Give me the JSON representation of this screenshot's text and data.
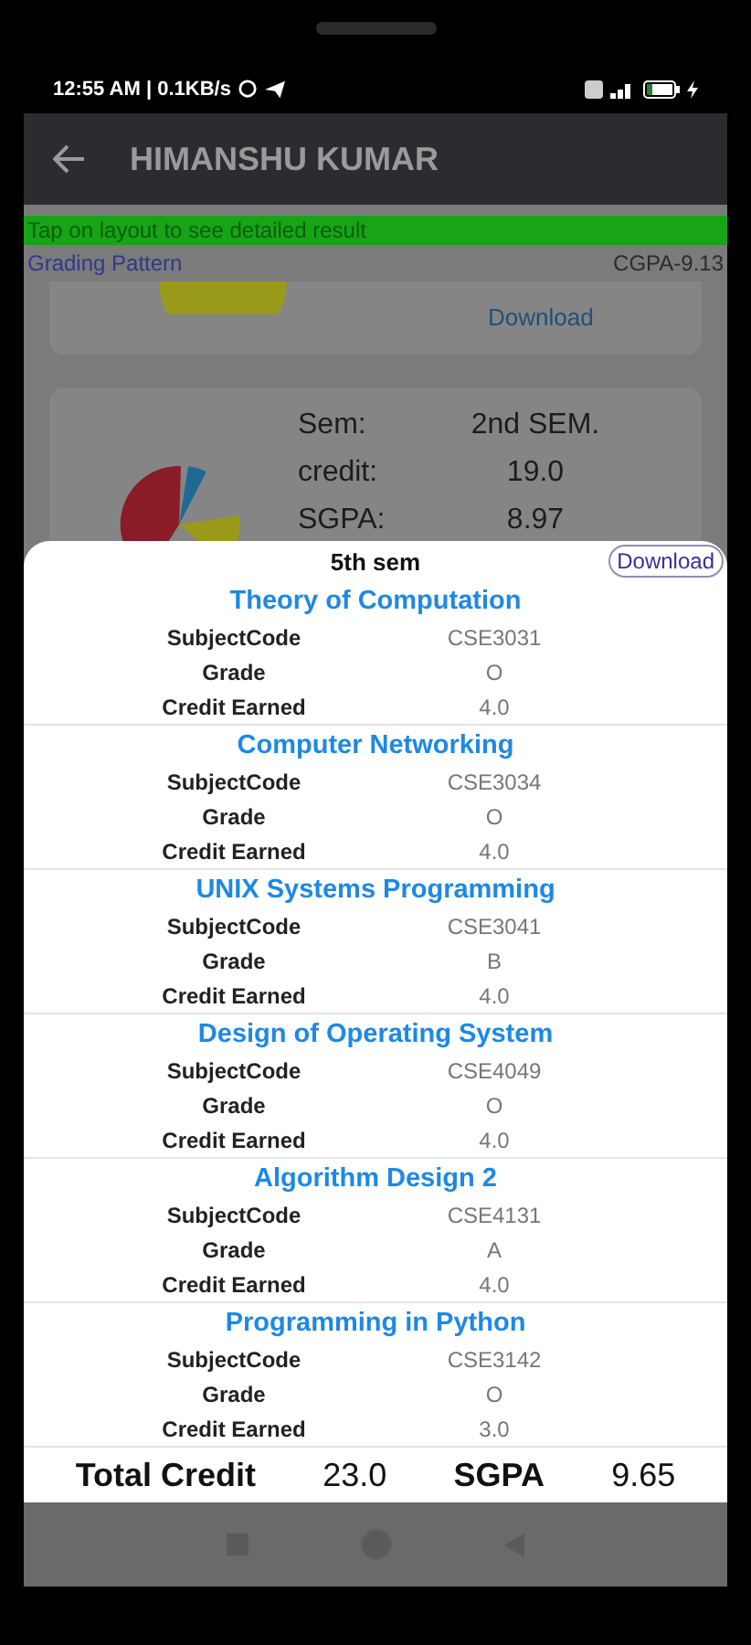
{
  "status_bar": {
    "time": "12:55 AM | 0.1KB/s"
  },
  "app_bar": {
    "title": "HIMANSHU KUMAR"
  },
  "banner": "Tap on layout to see detailed result",
  "grading_link": "Grading Pattern",
  "cgpa": "CGPA-9.13",
  "first_card": {
    "action": "Download"
  },
  "second_card": {
    "fields": [
      {
        "label": "Sem:",
        "value": "2nd SEM."
      },
      {
        "label": "credit:",
        "value": "19.0"
      },
      {
        "label": "SGPA:",
        "value": "8.97"
      }
    ]
  },
  "sheet": {
    "title": "5th sem",
    "download": "Download",
    "subjects": [
      {
        "name": "Theory of Computation",
        "rows": [
          {
            "label": "SubjectCode",
            "value": "CSE3031"
          },
          {
            "label": "Grade",
            "value": "O"
          },
          {
            "label": "Credit Earned",
            "value": "4.0"
          }
        ]
      },
      {
        "name": "Computer Networking",
        "rows": [
          {
            "label": "SubjectCode",
            "value": "CSE3034"
          },
          {
            "label": "Grade",
            "value": "O"
          },
          {
            "label": "Credit Earned",
            "value": "4.0"
          }
        ]
      },
      {
        "name": "UNIX Systems Programming",
        "rows": [
          {
            "label": "SubjectCode",
            "value": "CSE3041"
          },
          {
            "label": "Grade",
            "value": "B"
          },
          {
            "label": "Credit Earned",
            "value": "4.0"
          }
        ]
      },
      {
        "name": "Design of Operating System",
        "rows": [
          {
            "label": "SubjectCode",
            "value": "CSE4049"
          },
          {
            "label": "Grade",
            "value": "O"
          },
          {
            "label": "Credit Earned",
            "value": "4.0"
          }
        ]
      },
      {
        "name": "Algorithm Design 2",
        "rows": [
          {
            "label": "SubjectCode",
            "value": "CSE4131"
          },
          {
            "label": "Grade",
            "value": "A"
          },
          {
            "label": "Credit Earned",
            "value": "4.0"
          }
        ]
      },
      {
        "name": "Programming in Python",
        "rows": [
          {
            "label": "SubjectCode",
            "value": "CSE3142"
          },
          {
            "label": "Grade",
            "value": "O"
          },
          {
            "label": "Credit Earned",
            "value": "3.0"
          }
        ]
      }
    ],
    "totals": [
      {
        "label": "Total Credit",
        "value": "23.0"
      },
      {
        "label": "SGPA",
        "value": "9.65"
      }
    ]
  }
}
